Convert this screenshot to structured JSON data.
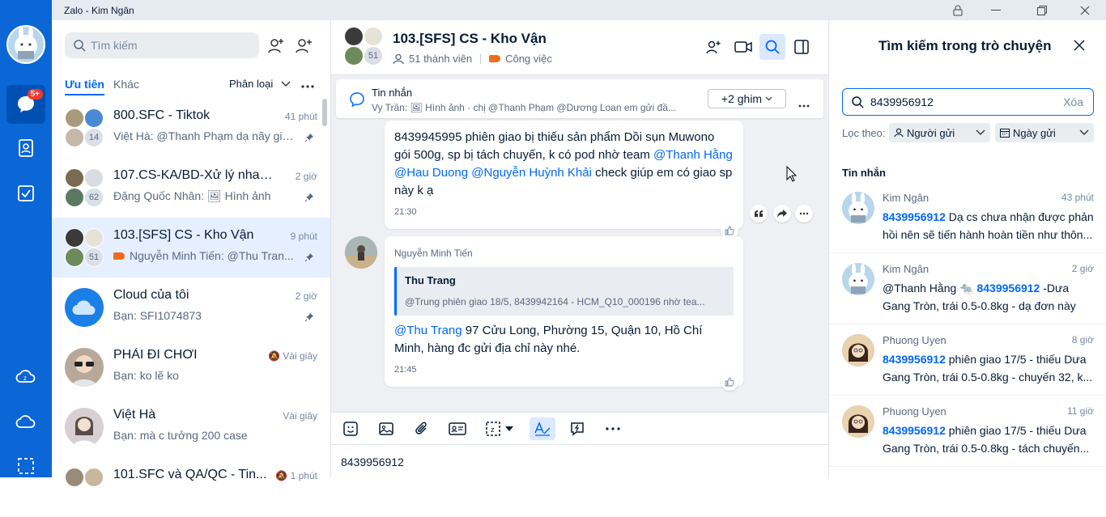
{
  "window": {
    "title": "Zalo - Kim Ngân"
  },
  "nav": {
    "badge": "5+"
  },
  "list": {
    "search_placeholder": "Tìm kiếm",
    "tabs": {
      "priority": "Ưu tiên",
      "other": "Khác",
      "classify": "Phân loại"
    },
    "conversations": [
      {
        "name": "800.SFC - Tiktok",
        "time": "41 phút",
        "preview": "Việt Hà: @Thanh Phạm dạ nãy giờ ...",
        "count": "14",
        "pinned": true
      },
      {
        "name": "107.CS-KA/BD-Xử lý nhanh k...",
        "time": "2 giờ",
        "preview": "Đặng Quốc Nhân: 🖼 Hình ảnh",
        "count": "62",
        "pinned": true
      },
      {
        "name": "103.[SFS] CS - Kho Vận",
        "time": "9 phút",
        "preview": "Nguyễn Minh Tiến: @Thu Tran...",
        "count": "51",
        "pinned": true
      },
      {
        "name": "Cloud của tôi",
        "time": "2 giờ",
        "preview": "Bạn: SFI1074873",
        "count": "",
        "pinned": true
      },
      {
        "name": "PHẢI ĐI CHƠI",
        "time": "Vài giây",
        "preview": "Bạn: ko lẽ ko",
        "count": "",
        "pinned": false
      },
      {
        "name": "Việt Hà",
        "time": "Vài giây",
        "preview": "Bạn: mà c tưởng 200 case",
        "count": "",
        "pinned": false
      },
      {
        "name": "101.SFC và QA/QC - Tin...",
        "time": "1 phút",
        "preview": "",
        "count": "",
        "pinned": false
      }
    ]
  },
  "chat": {
    "title": "103.[SFS] CS - Kho Vận",
    "members": "51 thành viên",
    "label": "Công việc",
    "avatar_count": "51",
    "pinned": {
      "title": "Tin nhắn",
      "text": "Vy Trần: 🖼 Hình ảnh · chị @Thanh Phạm @Dương Loan em gửi đầ...",
      "more_label": "+2 ghim"
    },
    "msg1": {
      "text_a": "8439945995 phiên giao bị thiếu sản phẩm Dồi sụn Muwono gói 500g, sp bị tách chuyến, k có pod nhờ team ",
      "m1": "@Thanh Hằng",
      "m2": "@Hau Duong",
      "m3": "@Nguyễn Huỳnh Khải",
      "text_b": " check giúp em  có giao sp này k ạ",
      "time": "21:30"
    },
    "msg2": {
      "sender": "Nguyễn Minh Tiến",
      "quote_name": "Thu Trang",
      "quote_text": "@Trung phiên giao 18/5, 8439942164 - HCM_Q10_000196 nhờ tea...",
      "mention": "@Thu Trang",
      "text": " 97 Cửu Long, Phường 15, Quận 10, Hồ Chí Minh, hàng đc gửi địa chỉ này nhé.",
      "time": "21:45"
    },
    "input_value": "8439956912"
  },
  "search_panel": {
    "title": "Tìm kiếm trong trò chuyện",
    "query": "8439956912",
    "clear": "Xóa",
    "filter_label": "Lọc theo:",
    "filter_sender": "Người gửi",
    "filter_date": "Ngày gửi",
    "section": "Tin nhắn",
    "results": [
      {
        "name": "Kim Ngân",
        "time": "43 phút",
        "hl": "8439956912",
        "pre": "",
        "text": " Dạ cs chưa nhận được phản hồi nên sẽ tiến hành hoàn tiền như thôn..."
      },
      {
        "name": "Kim Ngân",
        "time": "2 giờ",
        "hl": "8439956912",
        "pre": "@Thanh Hằng 🐀 ",
        "text": " -Dưa Gang Tròn, trái 0.5-0.8kg - dạ đơn này CS..."
      },
      {
        "name": "Phuong Uyen",
        "time": "8 giờ",
        "hl": "8439956912",
        "pre": "",
        "text": " phiên giao 17/5 - thiếu Dưa Gang Tròn, trái 0.5-0.8kg - chuyến 32, k..."
      },
      {
        "name": "Phuong Uyen",
        "time": "11 giờ",
        "hl": "8439956912",
        "pre": "",
        "text": " phiên giao 17/5 - thiếu Dưa Gang Tròn, trái 0.5-0.8kg - tách chuyến..."
      }
    ]
  }
}
